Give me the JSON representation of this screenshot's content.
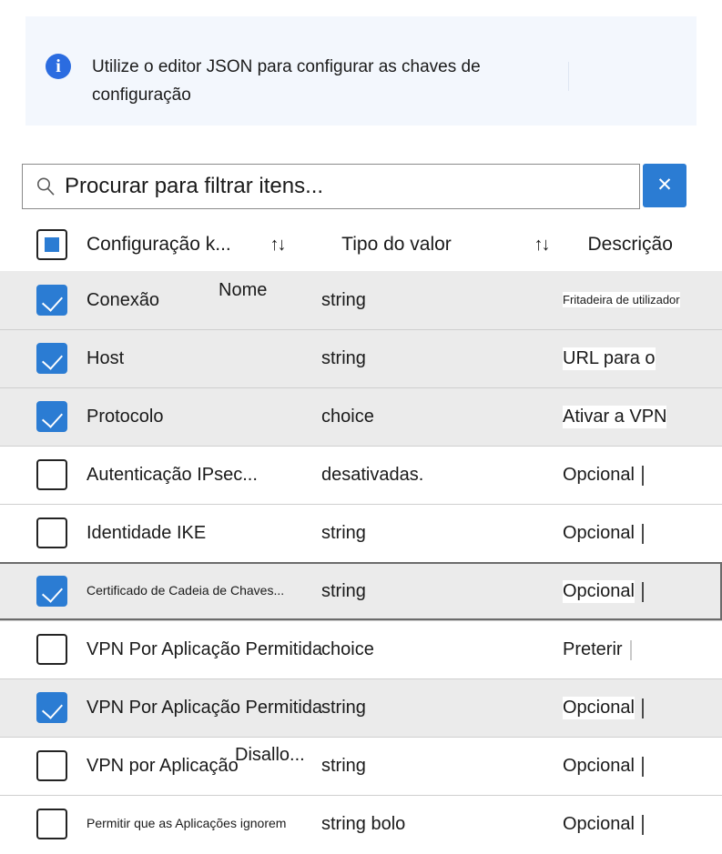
{
  "banner": {
    "icon": "info-icon",
    "text": "Utilize o editor JSON para configurar as chaves de configuração"
  },
  "search": {
    "icon": "search-icon",
    "placeholder": "Procurar para filtrar itens...",
    "value": "",
    "clear_label": "✕"
  },
  "table": {
    "header": {
      "select_all_state": "indeterminate",
      "columns": [
        {
          "label": "Configuração k...",
          "sort_icon": "↑↓"
        },
        {
          "label": "Tipo do valor",
          "sort_icon": "↑↓"
        },
        {
          "label": "Descrição",
          "sort_icon": ""
        }
      ]
    },
    "rows": [
      {
        "checked": true,
        "shaded": true,
        "focused": false,
        "key": "Conexão",
        "key_overlay": "Nome",
        "key_small": false,
        "type": "string",
        "desc": "Fritadeira de utilizador",
        "desc_small": true,
        "desc_clip": false
      },
      {
        "checked": true,
        "shaded": true,
        "focused": false,
        "key": "Host",
        "key_overlay": "",
        "key_small": false,
        "type": "string",
        "desc": "URL para o",
        "desc_small": false,
        "desc_clip": false
      },
      {
        "checked": true,
        "shaded": true,
        "focused": false,
        "key": "Protocolo",
        "key_overlay": "",
        "key_small": false,
        "type": "choice",
        "desc": "Ativar a VPN",
        "desc_small": false,
        "desc_clip": false
      },
      {
        "checked": false,
        "shaded": false,
        "focused": false,
        "key": "Autenticação IPsec...",
        "key_overlay": "",
        "key_small": false,
        "type": "desativadas.",
        "desc": "Opcional",
        "desc_small": false,
        "desc_clip": true
      },
      {
        "checked": false,
        "shaded": false,
        "focused": false,
        "key": "Identidade IKE",
        "key_overlay": "",
        "key_small": false,
        "type": "string",
        "desc": "Opcional",
        "desc_small": false,
        "desc_clip": true
      },
      {
        "checked": true,
        "shaded": true,
        "focused": true,
        "key": "Certificado de Cadeia de Chaves...",
        "key_overlay": "",
        "key_small": true,
        "type": "string",
        "desc": "Opcional",
        "desc_small": false,
        "desc_clip": true
      },
      {
        "checked": false,
        "shaded": false,
        "focused": false,
        "key": "VPN Por Aplicação Permitida",
        "key_overlay": "",
        "key_small": false,
        "type": "choice",
        "desc": "Preterir",
        "desc_small": false,
        "desc_clip": true
      },
      {
        "checked": true,
        "shaded": true,
        "focused": false,
        "key": "VPN Por Aplicação Permitida",
        "key_overlay": "",
        "key_small": false,
        "type": "string",
        "desc": "Opcional",
        "desc_small": false,
        "desc_clip": true
      },
      {
        "checked": false,
        "shaded": false,
        "focused": false,
        "key": "VPN por Aplicação",
        "key_overlay": "Disallo...",
        "key_small": false,
        "type": "string",
        "desc": "Opcional",
        "desc_small": false,
        "desc_clip": true
      },
      {
        "checked": false,
        "shaded": false,
        "focused": false,
        "key": "Permitir que as Aplicações ignorem",
        "key_overlay": "",
        "key_small": true,
        "type": "string bolo",
        "desc": "Opcional",
        "desc_small": false,
        "desc_clip": true
      }
    ]
  },
  "colors": {
    "accent": "#2b7cd3",
    "banner_bg": "#f3f7fd",
    "info_icon": "#2b6ce0",
    "row_shaded": "#ebebeb",
    "focus_border": "#6b6b6b"
  }
}
